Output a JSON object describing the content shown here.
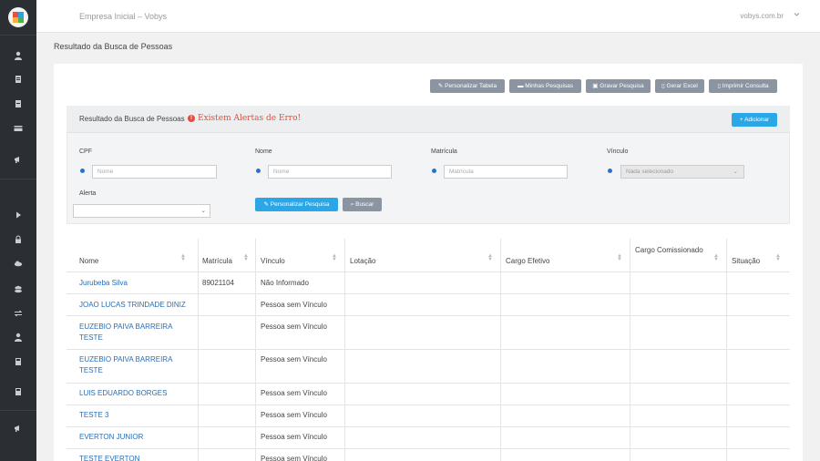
{
  "topbar": {
    "company": "Empresa Inicial – Vobys",
    "user": "vobys.com.br"
  },
  "page_title": "Resultado da Busca de Pessoas",
  "toolbar": [
    {
      "label": "Personalizar Tabela",
      "icon": "pencil-icon"
    },
    {
      "label": "Minhas Pesquisas",
      "icon": "folder-icon"
    },
    {
      "label": "Gravar Pesquisa",
      "icon": "save-icon"
    },
    {
      "label": "Gerar Excel",
      "icon": "file-icon"
    },
    {
      "label": "Imprimir Consulta",
      "icon": "file-icon"
    }
  ],
  "search": {
    "title": "Resultado da Busca de Pessoas",
    "alert": "Existem Alertas de Erro!",
    "add_label": "+ Adicionar",
    "fields": {
      "cpf": {
        "label": "CPF",
        "placeholder": "Nome"
      },
      "nome": {
        "label": "Nome",
        "placeholder": "Nome"
      },
      "matricula": {
        "label": "Matrícula",
        "placeholder": "Matrícula"
      },
      "vinculo": {
        "label": "Vínculo",
        "value": "Nada selecionado"
      },
      "alerta": {
        "label": "Alerta",
        "value": ""
      }
    },
    "personalize_label": "Personalizar Pesquisa",
    "search_label": "Buscar"
  },
  "table": {
    "headers": [
      "Nome",
      "Matrícula",
      "Vínculo",
      "Lotação",
      "Cargo Efetivo",
      "Cargo Comissionado",
      "Situação"
    ],
    "rows": [
      {
        "nome": "Jurubeba Silva",
        "matricula": "89021104",
        "vinculo": "Não Informado"
      },
      {
        "nome": "JOAO LUCAS TRINDADE DINIZ",
        "matricula": "",
        "vinculo": "Pessoa sem Vínculo"
      },
      {
        "nome": "EUZEBIO PAIVA BARREIRA TESTE",
        "matricula": "",
        "vinculo": "Pessoa sem Vínculo"
      },
      {
        "nome": "EUZEBIO PAIVA BARREIRA TESTE",
        "matricula": "",
        "vinculo": "Pessoa sem Vínculo"
      },
      {
        "nome": "LUIS EDUARDO BORGES",
        "matricula": "",
        "vinculo": "Pessoa sem Vínculo"
      },
      {
        "nome": "TESTE 3",
        "matricula": "",
        "vinculo": "Pessoa sem Vínculo"
      },
      {
        "nome": "EVERTON JUNIOR",
        "matricula": "",
        "vinculo": "Pessoa sem Vínculo"
      },
      {
        "nome": "TESTE EVERTON",
        "matricula": "",
        "vinculo": "Pessoa sem Vínculo"
      }
    ]
  },
  "sidebar_icons": [
    "user-icon",
    "document-icon",
    "file-icon",
    "card-icon",
    "megaphone-icon",
    "play-icon",
    "lock-icon",
    "cloud-icon",
    "group-icon",
    "swap-icon",
    "user-icon",
    "calculator-icon",
    "calculator-icon",
    "megaphone-icon"
  ]
}
